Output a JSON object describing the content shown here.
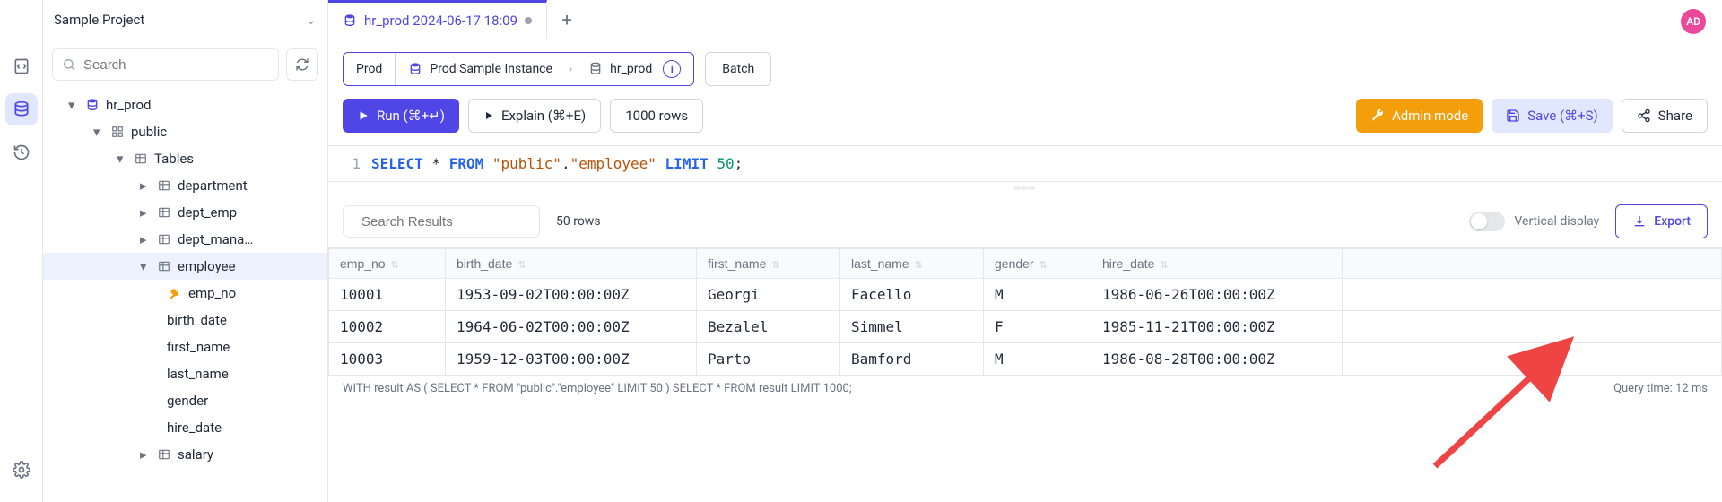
{
  "project": {
    "name": "Sample Project"
  },
  "sidebar": {
    "search_placeholder": "Search",
    "tree": {
      "db": "hr_prod",
      "schema": "public",
      "tables_label": "Tables",
      "tables": [
        "department",
        "dept_emp",
        "dept_mana…",
        "employee",
        "salary"
      ],
      "columns": [
        "emp_no",
        "birth_date",
        "first_name",
        "last_name",
        "gender",
        "hire_date"
      ]
    }
  },
  "tab": {
    "title": "hr_prod 2024-06-17 18:09"
  },
  "avatar": "AD",
  "breadcrumb": {
    "env": "Prod",
    "instance": "Prod Sample Instance",
    "database": "hr_prod"
  },
  "batch_label": "Batch",
  "toolbar": {
    "run": "Run (⌘+↵)",
    "explain": "Explain (⌘+E)",
    "limit": "1000 rows",
    "admin": "Admin mode",
    "save": "Save (⌘+S)",
    "share": "Share"
  },
  "editor": {
    "line_no": "1",
    "sql_parts": {
      "kw1": "SELECT",
      "star": " * ",
      "kw2": "FROM",
      "str1": " \"public\"",
      "dot": ".",
      "str2": "\"employee\" ",
      "kw3": "LIMIT",
      "num": " 50",
      "semi": ";"
    }
  },
  "results": {
    "search_placeholder": "Search Results",
    "count": "50 rows",
    "vertical_label": "Vertical display",
    "export_label": "Export",
    "columns": [
      "emp_no",
      "birth_date",
      "first_name",
      "last_name",
      "gender",
      "hire_date"
    ],
    "rows": [
      {
        "emp_no": "10001",
        "birth_date": "1953-09-02T00:00:00Z",
        "first_name": "Georgi",
        "last_name": "Facello",
        "gender": "M",
        "hire_date": "1986-06-26T00:00:00Z"
      },
      {
        "emp_no": "10002",
        "birth_date": "1964-06-02T00:00:00Z",
        "first_name": "Bezalel",
        "last_name": "Simmel",
        "gender": "F",
        "hire_date": "1985-11-21T00:00:00Z"
      },
      {
        "emp_no": "10003",
        "birth_date": "1959-12-03T00:00:00Z",
        "first_name": "Parto",
        "last_name": "Bamford",
        "gender": "M",
        "hire_date": "1986-08-28T00:00:00Z"
      }
    ]
  },
  "footer": {
    "sql": "WITH result AS ( SELECT * FROM \"public\".\"employee\" LIMIT 50 ) SELECT * FROM result LIMIT 1000;",
    "timing": "Query time: 12 ms"
  }
}
